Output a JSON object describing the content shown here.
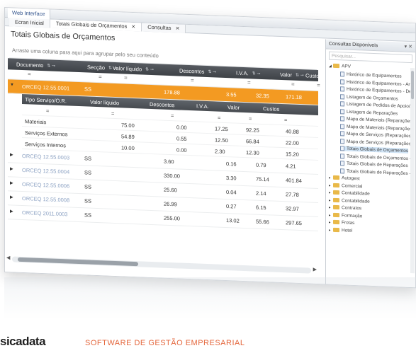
{
  "window": {
    "title": "Web Interface"
  },
  "tabs": [
    {
      "label": "Ecran Inicial",
      "closable": false
    },
    {
      "label": "Totais Globais de Orçamentos",
      "closable": true
    },
    {
      "label": "Consultas",
      "closable": true
    }
  ],
  "main": {
    "title": "Totais Globais de Orçamentos",
    "group_hint": "Arraste uma coluna para aqui para agrupar pelo seu conteúdo",
    "columns": [
      "Documento",
      "Secção",
      "Valor líquido",
      "Descontos",
      "I.V.A.",
      "Valor",
      "Custos"
    ],
    "filter_symbol": "=",
    "rows": [
      {
        "doc": "ORCEQ 12.55.0001",
        "seccao": "SS",
        "liquido": "178.88",
        "descontos": "3.55",
        "iva": "32.35",
        "valor": "171.18",
        "custos": "",
        "selected": true,
        "expander": "▼"
      },
      {
        "doc": "ORCEQ 12.55.0003",
        "seccao": "SS",
        "liquido": "3.60",
        "descontos": "0.16",
        "iva": "0.79",
        "valor": "4.21",
        "custos": "",
        "selected": false,
        "expander": "▶"
      },
      {
        "doc": "ORCEQ 12.55.0004",
        "seccao": "SS",
        "liquido": "330.00",
        "descontos": "3.30",
        "iva": "75.14",
        "valor": "401.84",
        "custos": "",
        "selected": false,
        "expander": "▶"
      },
      {
        "doc": "ORCEQ 12.55.0006",
        "seccao": "SS",
        "liquido": "25.60",
        "descontos": "0.04",
        "iva": "2.14",
        "valor": "27.78",
        "custos": "",
        "selected": false,
        "expander": "▶"
      },
      {
        "doc": "ORCEQ 12.55.0008",
        "seccao": "SS",
        "liquido": "26.99",
        "descontos": "0.27",
        "iva": "6.15",
        "valor": "32.97",
        "custos": "",
        "selected": false,
        "expander": "▶"
      },
      {
        "doc": "ORCEQ 2011.0003",
        "seccao": "SS",
        "liquido": "255.00",
        "descontos": "13.02",
        "iva": "55.66",
        "valor": "297.65",
        "custos": "",
        "selected": false,
        "expander": "▶"
      }
    ],
    "subgrid": {
      "columns": [
        "Tipo Serviço/O.R.",
        "Valor líquido",
        "Descontos",
        "I.V.A.",
        "Valor",
        "Custos"
      ],
      "rows": [
        {
          "tipo": "Materiais",
          "liquido": "75.00",
          "descontos": "0.00",
          "iva": "17.25",
          "valor": "92.25",
          "custos": "40.88"
        },
        {
          "tipo": "Serviços Externos",
          "liquido": "54.89",
          "descontos": "0.55",
          "iva": "12.50",
          "valor": "66.84",
          "custos": "22.00"
        },
        {
          "tipo": "Serviços Internos",
          "liquido": "10.00",
          "descontos": "0.00",
          "iva": "2.30",
          "valor": "12.30",
          "custos": "15.20"
        }
      ]
    }
  },
  "sidebar": {
    "title": "Consultas Disponíveis",
    "pins": "▾ ✕",
    "search_placeholder": "Pesquisar...",
    "root": "APV",
    "items": [
      "Histórico de Equipamentos",
      "Histórico de Equipamentos - Art",
      "Histórico de Equipamentos - Dev",
      "Listagem de Orçamentos",
      "Listagem de Pedidos de Apoio/A",
      "Listagem de Reparações",
      "Mapa de Materiais (Reparações)",
      "Mapa de Materiais (Reparações)",
      "Mapa de Serviços (Reparações)",
      "Mapa de Serviços (Reparações)",
      "Totais Globais de Orçamentos",
      "Totais Globais de Orçamentos -",
      "Totais Globais de Reparações",
      "Totais Globais de Reparações - I"
    ],
    "highlighted_index": 10,
    "folders": [
      "Autogest",
      "Comercial",
      "Contabilidade",
      "Contabilidade",
      "Contratos",
      "Formação",
      "Frotas",
      "Hotel"
    ]
  },
  "footer": {
    "brand": "sicadata",
    "tagline": "SOFTWARE DE GESTÃO EMPRESARIAL"
  },
  "colors": {
    "accent": "#f39a22",
    "header": "#3e4247",
    "link": "#8aa0c2",
    "brand_accent": "#e4673d"
  }
}
